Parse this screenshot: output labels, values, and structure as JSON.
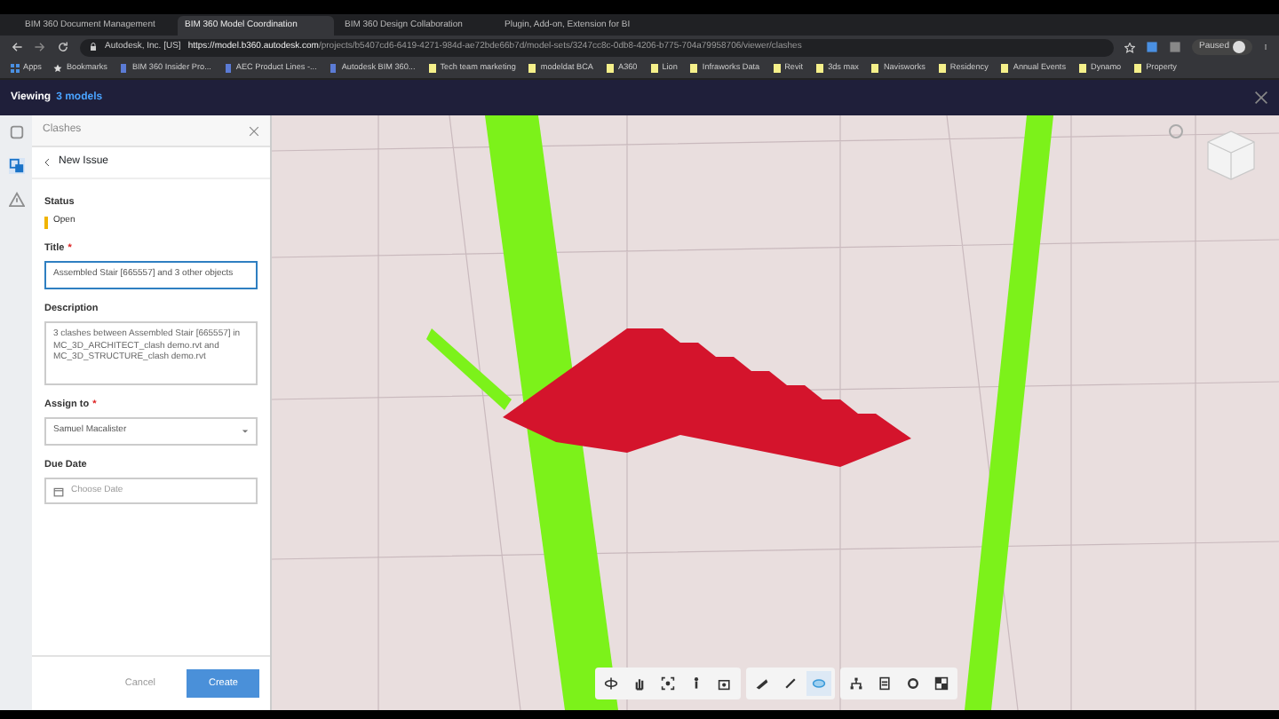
{
  "browser": {
    "tabs": [
      {
        "label": "BIM 360 Document Management",
        "selected": false
      },
      {
        "label": "BIM 360 Model Coordination",
        "selected": true
      },
      {
        "label": "BIM 360 Design Collaboration",
        "selected": false
      },
      {
        "label": "Plugin, Add-on, Extension for BI",
        "selected": false
      }
    ],
    "site": "Autodesk, Inc. [US]",
    "url_host": "https://model.b360.autodesk.com",
    "url_path": "/projects/b5407cd6-6419-4271-984d-ae72bde66b7d/model-sets/3247cc8c-0db8-4206-b775-704a79958706/viewer/clashes",
    "bookmarks": [
      {
        "label": "Apps",
        "kind": "apps"
      },
      {
        "label": "Bookmarks",
        "kind": "star"
      },
      {
        "label": "BIM 360 Insider Pro...",
        "kind": "page"
      },
      {
        "label": "AEC Product Lines -...",
        "kind": "page"
      },
      {
        "label": "Autodesk BIM 360...",
        "kind": "page"
      },
      {
        "label": "Tech team marketing",
        "kind": "folder"
      },
      {
        "label": "modeldat BCA",
        "kind": "folder"
      },
      {
        "label": "A360",
        "kind": "folder"
      },
      {
        "label": "Lion",
        "kind": "folder"
      },
      {
        "label": "Infraworks Data",
        "kind": "folder"
      },
      {
        "label": "Revit",
        "kind": "folder"
      },
      {
        "label": "3ds max",
        "kind": "folder"
      },
      {
        "label": "Navisworks",
        "kind": "folder"
      },
      {
        "label": "Residency",
        "kind": "folder"
      },
      {
        "label": "Annual Events",
        "kind": "folder"
      },
      {
        "label": "Dynamo",
        "kind": "folder"
      },
      {
        "label": "Property",
        "kind": "folder"
      }
    ],
    "profile": "Paused"
  },
  "header": {
    "prefix": "Viewing",
    "link": "3 models"
  },
  "sidebar": {
    "items": [
      {
        "kind": "square",
        "selected": false
      },
      {
        "kind": "clash",
        "selected": true
      },
      {
        "kind": "warning",
        "selected": false
      }
    ]
  },
  "panel": {
    "title": "Clashes",
    "back": "New Issue",
    "status": {
      "label": "Status",
      "value": "Open",
      "color": "#f0b400"
    },
    "title_field": {
      "label": "Title",
      "required": "*",
      "value": "Assembled Stair [665557] and 3 other objects"
    },
    "description": {
      "label": "Description",
      "value": "3 clashes between Assembled Stair [665557] in MC_3D_ARCHITECT_clash demo.rvt and MC_3D_STRUCTURE_clash demo.rvt"
    },
    "assign": {
      "label": "Assign to",
      "required": "*",
      "value": "Samuel Macalister"
    },
    "due": {
      "label": "Due Date",
      "placeholder": "Choose Date"
    },
    "buttons": {
      "cancel": "Cancel",
      "create": "Create"
    }
  },
  "toolbar": [
    [
      {
        "kind": "orbit",
        "selected": false
      },
      {
        "kind": "hand",
        "selected": false
      },
      {
        "kind": "fit",
        "selected": false
      },
      {
        "kind": "person",
        "selected": false
      },
      {
        "kind": "camera",
        "selected": false
      }
    ],
    [
      {
        "kind": "measure",
        "selected": false
      },
      {
        "kind": "pen",
        "selected": false
      },
      {
        "kind": "eye",
        "selected": true
      }
    ],
    [
      {
        "kind": "tree",
        "selected": false
      },
      {
        "kind": "props",
        "selected": false
      },
      {
        "kind": "gear",
        "selected": false
      },
      {
        "kind": "full",
        "selected": false
      }
    ]
  ]
}
